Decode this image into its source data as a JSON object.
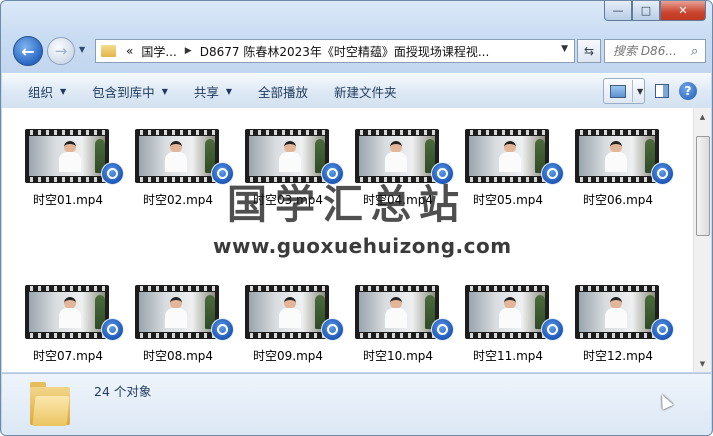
{
  "window": {
    "buttons": {
      "minimize": "—",
      "maximize": "□",
      "close": "✕"
    }
  },
  "nav": {
    "back_glyph": "←",
    "forward_glyph": "→",
    "history_dropdown_glyph": "▼",
    "address": {
      "prefix": "«",
      "segments": [
        "国学...",
        "D8677 陈春林2023年《时空精蕴》面授现场课程视..."
      ],
      "separator": "▶",
      "dropdown_glyph": "▼"
    },
    "refresh_glyph": "⇆",
    "search_placeholder": "搜索 D86...",
    "search_icon_glyph": "⌕"
  },
  "toolbar": {
    "organize": "组织",
    "include_in_library": "包含到库中",
    "share": "共享",
    "play_all": "全部播放",
    "new_folder": "新建文件夹",
    "dropdown_glyph": "▼",
    "view_dropdown_glyph": "▼",
    "help_glyph": "?"
  },
  "files": [
    "时空01.mp4",
    "时空02.mp4",
    "时空03.mp4",
    "时空04.mp4",
    "时空05.mp4",
    "时空06.mp4",
    "时空07.mp4",
    "时空08.mp4",
    "时空09.mp4",
    "时空10.mp4",
    "时空11.mp4",
    "时空12.mp4"
  ],
  "scrollbar": {
    "up_glyph": "▲",
    "down_glyph": "▼"
  },
  "watermark": {
    "title": "国学汇总站",
    "url": "www.guoxuehuizong.com"
  },
  "status": {
    "count_text": "24 个对象"
  },
  "icons": {
    "video_badge": "media-player-icon",
    "folder": "folder-icon",
    "cursor": "mouse-cursor-icon"
  }
}
